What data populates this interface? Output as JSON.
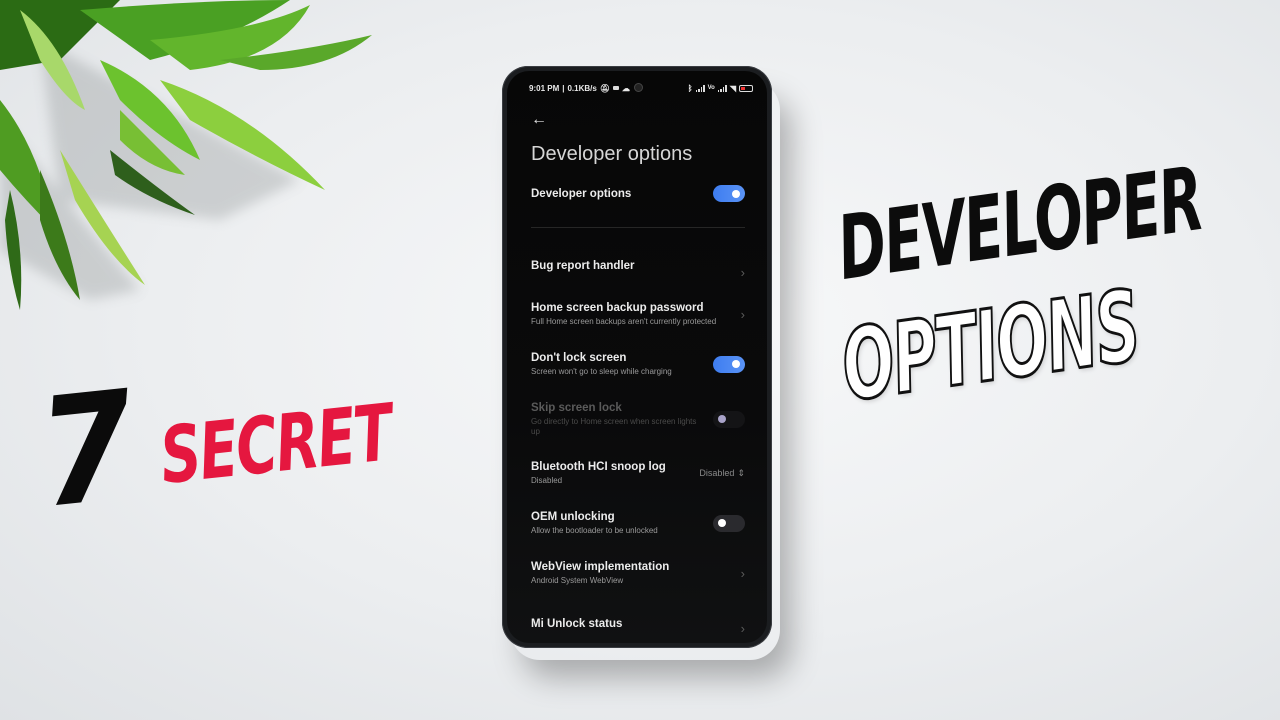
{
  "thumbnail": {
    "headline_number": "7",
    "headline_word": "SECRET",
    "headline_line1": "DEVELOPER",
    "headline_line2": "OPTIONS",
    "colors": {
      "accent_red": "#e5173f",
      "toggle_blue": "#3e7df0",
      "background": "#eceef0"
    }
  },
  "phone": {
    "statusbar": {
      "time": "9:01 PM",
      "separator": "|",
      "net_speed": "0.1KB/s",
      "left_icons": [
        "mute-icon",
        "message-icon",
        "cloud-icon"
      ],
      "right_icons": [
        "bluetooth-icon",
        "signal-icon",
        "volte-icon",
        "signal-icon",
        "wifi-icon",
        "battery-icon"
      ],
      "volte_label": "Vo"
    },
    "header": {
      "back_icon": "←",
      "title": "Developer options"
    },
    "settings": [
      {
        "title": "Developer options",
        "subtitle": "",
        "control": "toggle",
        "state": "on"
      },
      {
        "title": "Bug report handler",
        "subtitle": "",
        "control": "chevron"
      },
      {
        "title": "Home screen backup password",
        "subtitle": "Full Home screen backups aren't currently protected",
        "control": "chevron"
      },
      {
        "title": "Don't lock screen",
        "subtitle": "Screen won't go to sleep while charging",
        "control": "toggle",
        "state": "on"
      },
      {
        "title": "Skip screen lock",
        "subtitle": "Go directly to Home screen when screen lights up",
        "control": "toggle",
        "state": "off",
        "disabled": true
      },
      {
        "title": "Bluetooth HCI snoop log",
        "subtitle": "Disabled",
        "control": "select",
        "value": "Disabled"
      },
      {
        "title": "OEM unlocking",
        "subtitle": "Allow the bootloader to be unlocked",
        "control": "toggle",
        "state": "off"
      },
      {
        "title": "WebView implementation",
        "subtitle": "Android System WebView",
        "control": "chevron"
      },
      {
        "title": "Mi Unlock status",
        "subtitle": "",
        "control": "chevron"
      }
    ],
    "glyphs": {
      "chevron": "›",
      "select_arrows": "⇕"
    }
  }
}
